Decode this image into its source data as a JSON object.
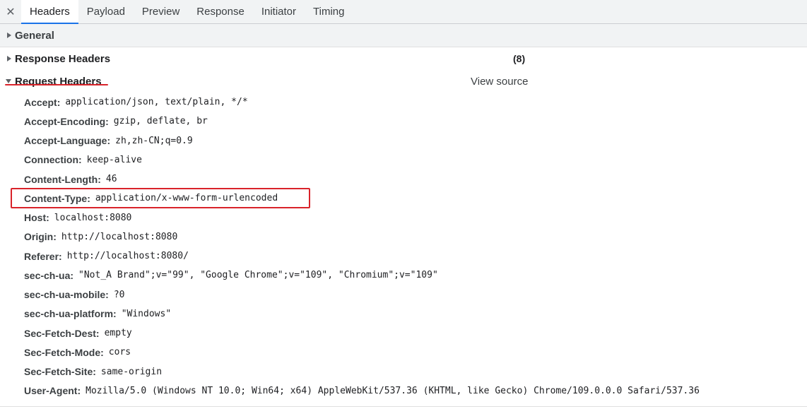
{
  "tabs": {
    "close_symbol": "✕",
    "items": [
      "Headers",
      "Payload",
      "Preview",
      "Response",
      "Initiator",
      "Timing"
    ],
    "active": "Headers"
  },
  "sections": {
    "general": {
      "title": "General"
    },
    "response_headers": {
      "title": "Response Headers",
      "count": "(8)"
    },
    "request_headers": {
      "title": "Request Headers",
      "view_source": "View source"
    }
  },
  "request_headers": [
    {
      "name": "Accept",
      "value": "application/json, text/plain, */*"
    },
    {
      "name": "Accept-Encoding",
      "value": "gzip, deflate, br"
    },
    {
      "name": "Accept-Language",
      "value": "zh,zh-CN;q=0.9"
    },
    {
      "name": "Connection",
      "value": "keep-alive"
    },
    {
      "name": "Content-Length",
      "value": "46"
    },
    {
      "name": "Content-Type",
      "value": "application/x-www-form-urlencoded"
    },
    {
      "name": "Host",
      "value": "localhost:8080"
    },
    {
      "name": "Origin",
      "value": "http://localhost:8080"
    },
    {
      "name": "Referer",
      "value": "http://localhost:8080/"
    },
    {
      "name": "sec-ch-ua",
      "value": "\"Not_A Brand\";v=\"99\", \"Google Chrome\";v=\"109\", \"Chromium\";v=\"109\""
    },
    {
      "name": "sec-ch-ua-mobile",
      "value": "?0"
    },
    {
      "name": "sec-ch-ua-platform",
      "value": "\"Windows\""
    },
    {
      "name": "Sec-Fetch-Dest",
      "value": "empty"
    },
    {
      "name": "Sec-Fetch-Mode",
      "value": "cors"
    },
    {
      "name": "Sec-Fetch-Site",
      "value": "same-origin"
    },
    {
      "name": "User-Agent",
      "value": "Mozilla/5.0 (Windows NT 10.0; Win64; x64) AppleWebKit/537.36 (KHTML, like Gecko) Chrome/109.0.0.0 Safari/537.36"
    }
  ],
  "colors": {
    "accent": "#1a73e8",
    "annotation_red": "#d9232a"
  }
}
